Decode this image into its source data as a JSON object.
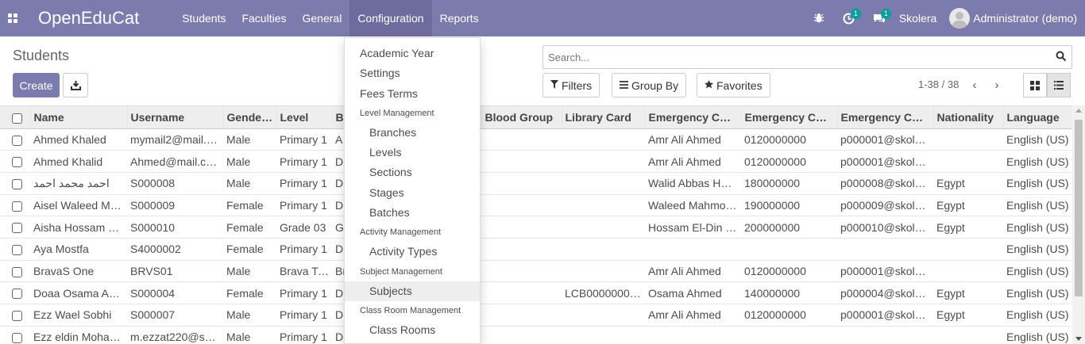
{
  "nav": {
    "brand": "OpenEduCat",
    "menu": [
      "Students",
      "Faculties",
      "General",
      "Configuration",
      "Reports"
    ],
    "active_menu": "Configuration",
    "activity_badge": "1",
    "messages_badge": "1",
    "company": "Skolera",
    "user": "Administrator (demo)"
  },
  "control": {
    "title": "Students",
    "create_label": "Create",
    "search_placeholder": "Search...",
    "filters_label": "Filters",
    "groupby_label": "Group By",
    "favorites_label": "Favorites",
    "pager": "1-38 / 38"
  },
  "table": {
    "columns": [
      "Name",
      "Username",
      "Gender...",
      "Level",
      "B",
      "",
      "Blood Group",
      "Library Card",
      "Emergency Con...",
      "Emergency Con...",
      "Emergency Con...",
      "Nationality",
      "Language"
    ],
    "rows": [
      [
        "Ahmed Khaled",
        "mymail2@mail.com",
        "Male",
        "Primary 1",
        "A",
        "",
        "",
        "",
        "Amr Ali Ahmed",
        "0120000000",
        "p000001@skoler...",
        "",
        "English (US)"
      ],
      [
        "Ahmed Khalid",
        "Ahmed@mail.com",
        "Male",
        "Primary 1",
        "Dl",
        "",
        "",
        "",
        "Amr Ali Ahmed",
        "0120000000",
        "p000001@skoler...",
        "",
        "English (US)"
      ],
      [
        "احمد محمد احمد",
        "S000008",
        "Male",
        "Primary 1",
        "Dl",
        "",
        "",
        "",
        "Walid Abbas Hus...",
        "180000000",
        "p000008@skoler...",
        "Egypt",
        "English (US)"
      ],
      [
        "Aisel Waleed Ma...",
        "S000009",
        "Female",
        "Primary 1",
        "Dl",
        "",
        "",
        "",
        "Waleed Mahmou...",
        "190000000",
        "p000009@skoler...",
        "Egypt",
        "English (US)"
      ],
      [
        "Aisha Hossam El...",
        "S000010",
        "Female",
        "Grade 03",
        "G",
        "",
        "",
        "",
        "Hossam El-Din H...",
        "200000000",
        "p000010@skoler...",
        "Egypt",
        "English (US)"
      ],
      [
        "Aya Mostfa",
        "S4000002",
        "Female",
        "Primary 1",
        "Dl",
        "",
        "",
        "",
        "",
        "",
        "",
        "",
        "English (US)"
      ],
      [
        "BravaS One",
        "BRVS01",
        "Male",
        "Brava Two",
        "Br",
        "",
        "",
        "",
        "Amr Ali Ahmed",
        "0120000000",
        "p000001@skoler...",
        "",
        "English (US)"
      ],
      [
        "Doaa Osama Ah...",
        "S000004",
        "Female",
        "Primary 1",
        "Dl",
        "",
        "",
        "LCB0000000001",
        "Osama Ahmed",
        "140000000",
        "p000004@skoler...",
        "Egypt",
        "English (US)"
      ],
      [
        "Ezz Wael Sobhi",
        "S000007",
        "Male",
        "Primary 1",
        "Dl",
        "",
        "",
        "",
        "Amr Ali Ahmed",
        "0120000000",
        "p000001@skoler...",
        "Egypt",
        "English (US)"
      ],
      [
        "Ezz eldin Moham...",
        "m.ezzat220@sko...",
        "Male",
        "Primary 1",
        "Dl",
        "",
        "",
        "",
        "",
        "",
        "",
        "",
        "English (US)"
      ]
    ]
  },
  "dropdown": {
    "items": [
      {
        "type": "item",
        "label": "Academic Year"
      },
      {
        "type": "item",
        "label": "Settings"
      },
      {
        "type": "item",
        "label": "Fees Terms"
      },
      {
        "type": "header",
        "label": "Level Management"
      },
      {
        "type": "sub",
        "label": "Branches"
      },
      {
        "type": "sub",
        "label": "Levels"
      },
      {
        "type": "sub",
        "label": "Sections"
      },
      {
        "type": "sub",
        "label": "Stages"
      },
      {
        "type": "sub",
        "label": "Batches"
      },
      {
        "type": "header",
        "label": "Activity Management"
      },
      {
        "type": "sub",
        "label": "Activity Types"
      },
      {
        "type": "header",
        "label": "Subject Management"
      },
      {
        "type": "sub",
        "label": "Subjects",
        "highlighted": true
      },
      {
        "type": "header",
        "label": "Class Room Management"
      },
      {
        "type": "sub",
        "label": "Class Rooms"
      }
    ]
  },
  "colors": {
    "navbar": "#7c7bad",
    "primary_button": "#7c7bad",
    "badge": "#00a09d"
  }
}
